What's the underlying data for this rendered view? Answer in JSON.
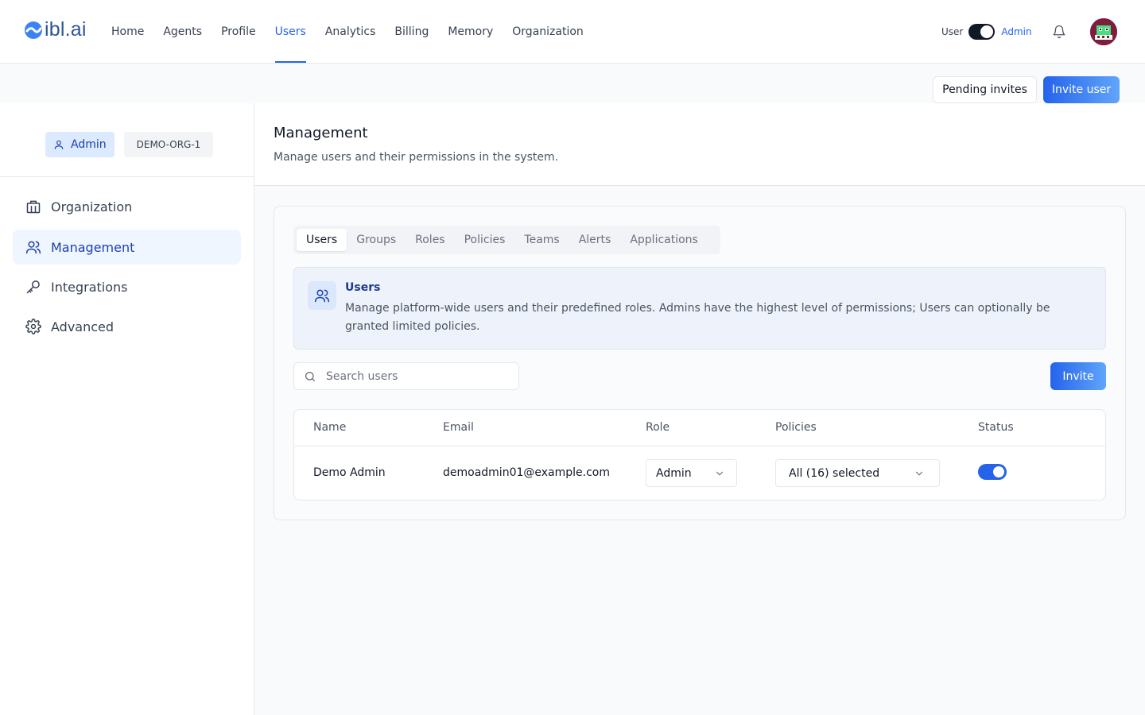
{
  "brand": {
    "name": "ibl.ai"
  },
  "nav": {
    "items": [
      {
        "label": "Home",
        "active": false
      },
      {
        "label": "Agents",
        "active": false
      },
      {
        "label": "Profile",
        "active": false
      },
      {
        "label": "Users",
        "active": true
      },
      {
        "label": "Analytics",
        "active": false
      },
      {
        "label": "Billing",
        "active": false
      },
      {
        "label": "Memory",
        "active": false
      },
      {
        "label": "Organization",
        "active": false
      }
    ]
  },
  "mode_toggle": {
    "left_label": "User",
    "right_label": "Admin",
    "selected": "Admin"
  },
  "actions": {
    "pending_label": "Pending invites",
    "invite_label": "Invite user"
  },
  "sidebar": {
    "role_badge": "Admin",
    "org_badge": "DEMO-ORG-1",
    "items": [
      {
        "label": "Organization",
        "icon": "building-icon",
        "active": false
      },
      {
        "label": "Management",
        "icon": "users-icon",
        "active": true
      },
      {
        "label": "Integrations",
        "icon": "key-icon",
        "active": false
      },
      {
        "label": "Advanced",
        "icon": "gear-icon",
        "active": false
      }
    ]
  },
  "page": {
    "title": "Management",
    "subtitle": "Manage users and their permissions in the system."
  },
  "tabs": [
    {
      "label": "Users",
      "active": true
    },
    {
      "label": "Groups",
      "active": false
    },
    {
      "label": "Roles",
      "active": false
    },
    {
      "label": "Policies",
      "active": false
    },
    {
      "label": "Teams",
      "active": false
    },
    {
      "label": "Alerts",
      "active": false
    },
    {
      "label": "Applications",
      "active": false
    }
  ],
  "info": {
    "title": "Users",
    "description": "Manage platform-wide users and their predefined roles. Admins have the highest level of permissions; Users can optionally be granted limited policies."
  },
  "search": {
    "placeholder": "Search users",
    "value": ""
  },
  "invite_button": "Invite",
  "table": {
    "columns": [
      "Name",
      "Email",
      "Role",
      "Policies",
      "Status"
    ],
    "rows": [
      {
        "name": "Demo Admin",
        "email": "demoadmin01@example.com",
        "role": "Admin",
        "policies": "All (16) selected",
        "status": true
      }
    ]
  },
  "colors": {
    "accent": "#2563eb",
    "active_bg": "#eff6ff",
    "info_bg": "#eef3fb"
  }
}
